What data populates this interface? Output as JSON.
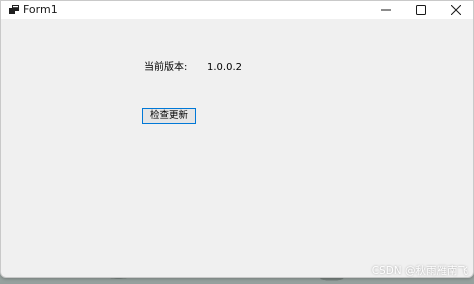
{
  "window": {
    "title": "Form1",
    "controls": {
      "minimize": "minimize-icon",
      "maximize": "maximize-icon",
      "close": "close-icon"
    }
  },
  "form": {
    "version_label": "当前版本:",
    "version_value": "1.0.0.2",
    "check_update_button": "检查更新"
  },
  "watermark": "CSDN @秋雨雁南飞",
  "colors": {
    "window_bg": "#f0f0f0",
    "titlebar_bg": "#ffffff",
    "button_border": "#0078d7"
  }
}
